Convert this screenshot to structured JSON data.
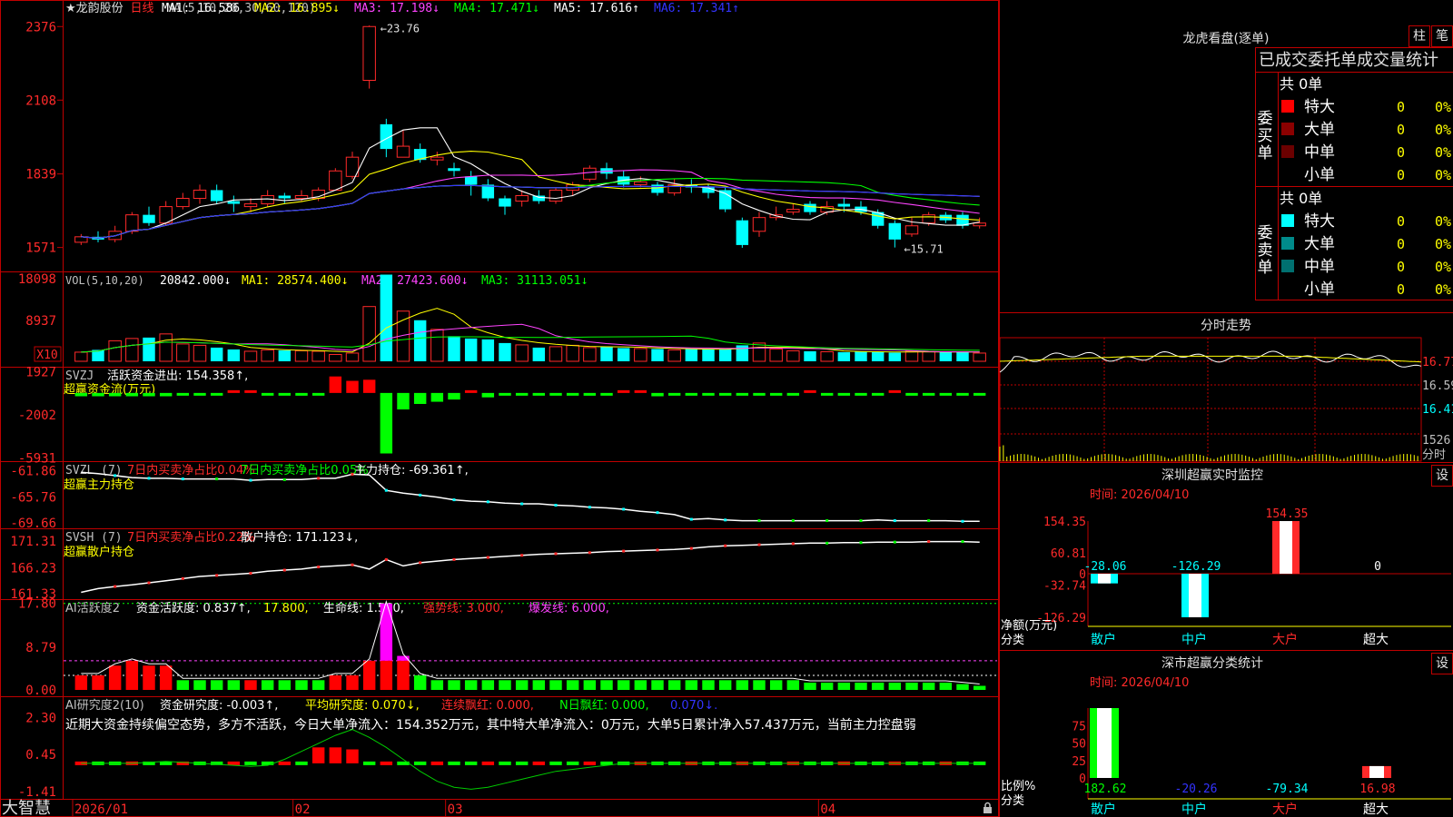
{
  "app": {
    "brand": "大智慧",
    "stock_name": "★龙韵股份",
    "period": "日线",
    "lock_icon": "lock-icon"
  },
  "colors": {
    "up": "#ff2a2a",
    "down": "#00ffff",
    "grid": "#c00000",
    "bg": "#000000"
  },
  "main_chart": {
    "ma_params": "MA(5,10,20,30,60,120)",
    "ma": [
      {
        "label": "MA1:",
        "value": "16.586",
        "color": "#ffffff"
      },
      {
        "label": "MA2:",
        "value": "16.895↓",
        "color": "#ffff00"
      },
      {
        "label": "MA3:",
        "value": "17.198↓",
        "color": "#ff44ff"
      },
      {
        "label": "MA4:",
        "value": "17.471↓",
        "color": "#00ff00"
      },
      {
        "label": "MA5:",
        "value": "17.616↑",
        "color": "#ffffff"
      },
      {
        "label": "MA6:",
        "value": "17.341↑",
        "color": "#3333ff"
      }
    ],
    "y_ticks": [
      "2376",
      "2108",
      "1839",
      "1571"
    ],
    "high_label": "23.76",
    "low_label": "←15.71",
    "ylim": [
      15.4,
      24.0
    ],
    "candles": [
      [
        15.9,
        16.1,
        15.8,
        16.2
      ],
      [
        16.1,
        16.0,
        15.9,
        16.3
      ],
      [
        16.0,
        16.3,
        15.9,
        16.5
      ],
      [
        16.3,
        16.9,
        16.2,
        17.0
      ],
      [
        16.9,
        16.6,
        16.5,
        17.2
      ],
      [
        16.6,
        17.2,
        16.5,
        17.4
      ],
      [
        17.2,
        17.5,
        17.1,
        17.7
      ],
      [
        17.5,
        17.8,
        17.3,
        18.0
      ],
      [
        17.8,
        17.4,
        17.3,
        18.0
      ],
      [
        17.4,
        17.3,
        17.0,
        17.6
      ],
      [
        17.2,
        17.3,
        17.0,
        17.5
      ],
      [
        17.3,
        17.6,
        17.2,
        17.8
      ],
      [
        17.6,
        17.5,
        17.3,
        17.7
      ],
      [
        17.5,
        17.6,
        17.4,
        17.8
      ],
      [
        17.5,
        17.8,
        17.4,
        17.9
      ],
      [
        17.8,
        18.5,
        17.8,
        18.6
      ],
      [
        18.3,
        19.0,
        18.2,
        19.2
      ],
      [
        21.8,
        23.76,
        21.5,
        23.8
      ],
      [
        20.2,
        19.3,
        19.0,
        20.4
      ],
      [
        19.0,
        19.4,
        19.0,
        20.0
      ],
      [
        19.3,
        18.9,
        18.8,
        19.5
      ],
      [
        18.9,
        19.0,
        18.7,
        19.2
      ],
      [
        18.6,
        18.5,
        18.3,
        18.8
      ],
      [
        18.3,
        18.0,
        17.6,
        18.5
      ],
      [
        18.0,
        17.5,
        17.4,
        18.2
      ],
      [
        17.5,
        17.2,
        16.9,
        17.6
      ],
      [
        17.4,
        17.6,
        17.2,
        17.8
      ],
      [
        17.6,
        17.4,
        17.3,
        17.8
      ],
      [
        17.4,
        17.8,
        17.3,
        17.9
      ],
      [
        17.8,
        18.0,
        17.6,
        18.1
      ],
      [
        18.2,
        18.6,
        18.1,
        18.7
      ],
      [
        18.6,
        18.4,
        18.2,
        18.8
      ],
      [
        18.3,
        18.0,
        17.9,
        18.5
      ],
      [
        18.0,
        18.1,
        17.9,
        18.3
      ],
      [
        18.0,
        17.7,
        17.6,
        18.1
      ],
      [
        17.7,
        18.0,
        17.6,
        18.2
      ],
      [
        18.0,
        17.9,
        17.7,
        18.2
      ],
      [
        17.9,
        17.7,
        17.5,
        18.0
      ],
      [
        17.8,
        17.1,
        17.0,
        17.9
      ],
      [
        16.7,
        15.8,
        15.7,
        16.8
      ],
      [
        16.3,
        16.8,
        16.1,
        17.0
      ],
      [
        16.8,
        16.9,
        16.7,
        17.2
      ],
      [
        17.0,
        17.1,
        16.9,
        17.3
      ],
      [
        17.3,
        17.0,
        16.9,
        17.4
      ],
      [
        17.0,
        17.2,
        16.9,
        17.4
      ],
      [
        17.3,
        17.2,
        17.0,
        17.5
      ],
      [
        17.2,
        17.0,
        16.9,
        17.4
      ],
      [
        17.0,
        16.5,
        16.4,
        17.1
      ],
      [
        16.6,
        16.0,
        15.71,
        16.7
      ],
      [
        16.2,
        16.5,
        16.1,
        16.8
      ],
      [
        16.6,
        16.9,
        16.5,
        17.0
      ],
      [
        16.9,
        16.7,
        16.6,
        17.0
      ],
      [
        16.9,
        16.5,
        16.4,
        17.0
      ],
      [
        16.5,
        16.6,
        16.4,
        16.8
      ]
    ]
  },
  "vol": {
    "params": "VOL(5,10,20)",
    "value": "20842.000↓",
    "ma": [
      {
        "label": "MA1:",
        "value": "28574.400↓",
        "color": "#ffff00"
      },
      {
        "label": "MA2:",
        "value": "27423.600↓",
        "color": "#ff44ff"
      },
      {
        "label": "MA3:",
        "value": "31113.051↓",
        "color": "#00ff00"
      }
    ],
    "y_ticks": [
      "18098",
      "8937"
    ],
    "unit": "X10",
    "ymax": 19500,
    "values": [
      2000,
      2500,
      4500,
      5000,
      5200,
      6000,
      3800,
      3500,
      3000,
      2600,
      2200,
      2500,
      2400,
      2300,
      2200,
      1500,
      1800,
      12000,
      19000,
      11000,
      9000,
      7000,
      5500,
      5000,
      4800,
      4000,
      3600,
      3000,
      3200,
      3500,
      3000,
      3200,
      2900,
      2800,
      2700,
      2500,
      2700,
      2600,
      2600,
      3500,
      4000,
      2700,
      2300,
      2200,
      2100,
      2000,
      2100,
      2000,
      1900,
      2200,
      2100,
      2000,
      2000,
      1800
    ]
  },
  "svzj": {
    "name": "SVZJ",
    "label": "活跃资金进出:",
    "value": "154.358↑,",
    "subtitle": "超赢资金流(万元)",
    "y_ticks": [
      "1927",
      "-2002",
      "-5931"
    ],
    "ylim": [
      -6200,
      2300
    ],
    "values": [
      -300,
      -300,
      -300,
      -300,
      -300,
      -300,
      -200,
      -200,
      -100,
      100,
      80,
      -100,
      -200,
      -250,
      -200,
      1500,
      1100,
      1200,
      -5500,
      -1500,
      -1000,
      -800,
      -600,
      100,
      -400,
      -200,
      -200,
      -200,
      -150,
      -100,
      -250,
      -150,
      50,
      200,
      -300,
      -200,
      -150,
      -200,
      -150,
      -200,
      -150,
      -200,
      -200,
      100,
      -150,
      -100,
      -200,
      -200,
      150,
      -250,
      -200,
      -200,
      -200,
      -200
    ]
  },
  "svzl": {
    "name": "SVZL (7)",
    "pct1": "7日内买卖净占比0.04%",
    "pct2": "7日内买卖净占比0.05%",
    "label": "主力持仓:",
    "value": "-69.361↑,",
    "subtitle": "超赢主力持仓",
    "y_ticks": [
      "-61.86",
      "-65.76",
      "-69.66"
    ],
    "ylim": [
      -69.9,
      -61.4
    ],
    "values": [
      -62.1,
      -62.3,
      -62.6,
      -62.9,
      -63.0,
      -63.0,
      -63.1,
      -63.1,
      -63.1,
      -63.1,
      -63.3,
      -63.2,
      -63.2,
      -63.2,
      -63.0,
      -63.0,
      -62.4,
      -62.5,
      -64.8,
      -65.2,
      -65.5,
      -65.8,
      -66.2,
      -66.4,
      -66.5,
      -66.7,
      -66.8,
      -66.8,
      -67.0,
      -67.1,
      -67.3,
      -67.4,
      -67.6,
      -67.9,
      -68.1,
      -68.4,
      -69.1,
      -69.0,
      -69.2,
      -69.3,
      -69.3,
      -69.3,
      -69.3,
      -69.3,
      -69.3,
      -69.3,
      -69.3,
      -69.2,
      -69.3,
      -69.3,
      -69.3,
      -69.3,
      -69.4,
      -69.4
    ]
  },
  "svsh": {
    "name": "SVSH (7)",
    "pct": "7日内买卖净占比0.22%",
    "label": "散户持仓:",
    "value": "171.123↓,",
    "subtitle": "超赢散户持仓",
    "y_ticks": [
      "171.31",
      "166.23",
      "161.33"
    ],
    "ylim": [
      161.0,
      172.5
    ],
    "values": [
      161.6,
      162.3,
      162.7,
      163.0,
      163.4,
      163.8,
      164.2,
      164.6,
      164.8,
      165.0,
      165.2,
      165.6,
      165.8,
      166.0,
      166.4,
      166.6,
      166.8,
      166.0,
      167.8,
      166.6,
      167.2,
      167.5,
      167.8,
      168.0,
      168.2,
      168.4,
      168.6,
      168.8,
      168.9,
      169.0,
      169.1,
      169.3,
      169.4,
      169.5,
      169.6,
      169.7,
      169.9,
      170.2,
      170.4,
      170.5,
      170.6,
      170.7,
      170.8,
      170.9,
      170.9,
      171.0,
      171.0,
      171.1,
      171.1,
      171.1,
      171.2,
      171.2,
      171.2,
      171.1
    ]
  },
  "ai_active": {
    "name": "AI活跃度2",
    "label": "资金活跃度:",
    "value": "0.837↑,",
    "v2": "17.800,",
    "life_label": "生命线:",
    "life_value": "1.560,",
    "strong": "强势线: 3.000,",
    "burst": "爆发线: 6.000,",
    "y_ticks": [
      "17.80",
      "8.79",
      "0.00"
    ],
    "ymax": 18.5,
    "strong_level": 3.0,
    "burst_level": 6.0,
    "top_level": 17.8,
    "values": [
      3,
      3,
      5,
      6,
      5,
      5,
      2,
      2,
      2,
      2,
      2,
      2,
      2,
      2,
      2,
      3,
      3,
      6,
      17.8,
      7,
      3,
      2,
      2,
      2,
      2,
      2,
      2,
      2,
      2,
      2,
      2,
      2,
      2,
      2,
      2,
      2,
      2,
      2,
      2,
      2,
      2,
      2,
      2,
      1.5,
      1.5,
      1.5,
      1.5,
      1.5,
      1.5,
      1.5,
      1.5,
      1.5,
      1.2,
      0.84
    ],
    "colors": [
      0,
      0,
      0,
      0,
      0,
      0,
      1,
      1,
      1,
      1,
      0,
      1,
      1,
      1,
      1,
      0,
      0,
      0,
      2,
      2,
      1,
      1,
      1,
      1,
      1,
      1,
      1,
      1,
      1,
      1,
      1,
      1,
      1,
      1,
      1,
      1,
      1,
      1,
      1,
      1,
      1,
      1,
      1,
      1,
      1,
      1,
      1,
      1,
      1,
      1,
      1,
      1,
      1,
      1
    ]
  },
  "ai_research": {
    "name": "AI研究度2(10)",
    "label": "资金研究度:",
    "value": "-0.003↑,",
    "avg": "平均研究度: 0.070↓,",
    "cont": "连续飘红: 0.000,",
    "nday": "N日飘红: 0.000,",
    "tail": "0.070↓.",
    "comment": "近期大资金持续偏空态势，多方不活跃，今日大单净流入：154.352万元，其中特大单净流入：0万元，大单5日累计净入57.437万元，当前主力控盘弱",
    "y_ticks": [
      "2.30",
      "0.45",
      "-1.41"
    ],
    "ylim": [
      -1.6,
      2.5
    ],
    "bars": [
      0,
      0,
      0,
      0,
      0,
      0,
      0,
      0,
      0,
      0,
      0,
      0,
      0,
      0,
      0.8,
      0.8,
      0.7,
      0,
      0,
      0,
      0,
      0,
      0,
      0,
      0,
      0,
      0,
      0,
      0,
      0,
      0,
      0,
      0,
      0,
      0,
      0,
      0,
      0,
      0,
      0,
      0,
      0,
      0,
      0,
      0,
      0,
      0,
      0,
      0,
      0,
      0,
      0,
      0,
      0
    ],
    "line": [
      0,
      0,
      0,
      0,
      0.05,
      0.1,
      0.05,
      0,
      -0.05,
      -0.1,
      -0.15,
      -0.1,
      0.2,
      0.6,
      1.0,
      1.4,
      1.7,
      1.3,
      0.8,
      0.2,
      -0.4,
      -0.9,
      -1.2,
      -1.3,
      -1.2,
      -1.0,
      -0.8,
      -0.6,
      -0.4,
      -0.3,
      -0.2,
      -0.1,
      0,
      0,
      0,
      0,
      0,
      0,
      0,
      0,
      0,
      0,
      0,
      0,
      0,
      0,
      0,
      0,
      0,
      0,
      0,
      0,
      0,
      0
    ]
  },
  "x_axis": {
    "labels": [
      {
        "text": "2026/01",
        "i": 0
      },
      {
        "text": "02",
        "i": 13
      },
      {
        "text": "03",
        "i": 22
      },
      {
        "text": "04",
        "i": 44
      }
    ]
  },
  "right": {
    "title": "龙虎看盘(逐单)",
    "btn_zhu": "柱",
    "btn_bi": "笔",
    "stats_title": "已成交委托单成交量统计",
    "buy": {
      "side": "委买单",
      "total": "共 0单",
      "rows": [
        {
          "name": "特大",
          "count": "0",
          "pct": "0%",
          "color": "#ff0000"
        },
        {
          "name": "大单",
          "count": "0",
          "pct": "0%",
          "color": "#8b0000"
        },
        {
          "name": "中单",
          "count": "0",
          "pct": "0%",
          "color": "#6b0000"
        },
        {
          "name": "小单",
          "count": "0",
          "pct": "0%",
          "color": ""
        }
      ]
    },
    "sell": {
      "side": "委卖单",
      "total": "共 0单",
      "rows": [
        {
          "name": "特大",
          "count": "0",
          "pct": "0%",
          "color": "#00ffff"
        },
        {
          "name": "大单",
          "count": "0",
          "pct": "0%",
          "color": "#008b8b"
        },
        {
          "name": "中单",
          "count": "0",
          "pct": "0%",
          "color": "#007070"
        },
        {
          "name": "小单",
          "count": "0",
          "pct": "0%",
          "color": ""
        }
      ]
    },
    "intraday": {
      "title": "分时走势",
      "prices": [
        "16.77",
        "16.59",
        "16.41"
      ],
      "vol": "1526",
      "vol_unit": "分时"
    },
    "sz_monitor": {
      "title": "深圳超赢实时监控",
      "btn": "设",
      "time": "时间: 2026/04/10",
      "y_ticks": [
        "154.35",
        "60.81",
        "0",
        "-32.74",
        "-126.29"
      ],
      "unit": "净额(万元)",
      "unit2": "分类",
      "categories": [
        "散户",
        "中户",
        "大户",
        "超大"
      ],
      "values": [
        -28.06,
        -126.29,
        154.35,
        0
      ],
      "value_labels": [
        "-28.06",
        "-126.29",
        "154.35",
        "0"
      ]
    },
    "sz_stats": {
      "title": "深市超赢分类统计",
      "btn": "设",
      "time": "时间: 2026/04/10",
      "y_ticks": [
        "75",
        "50",
        "25",
        "0"
      ],
      "unit": "比例%",
      "unit2": "分类",
      "categories": [
        "散户",
        "中户",
        "大户",
        "超大"
      ],
      "values": [
        182.62,
        -20.26,
        -79.34,
        16.98
      ],
      "value_labels": [
        "182.62",
        "-20.26",
        "-79.34",
        "16.98"
      ]
    }
  }
}
